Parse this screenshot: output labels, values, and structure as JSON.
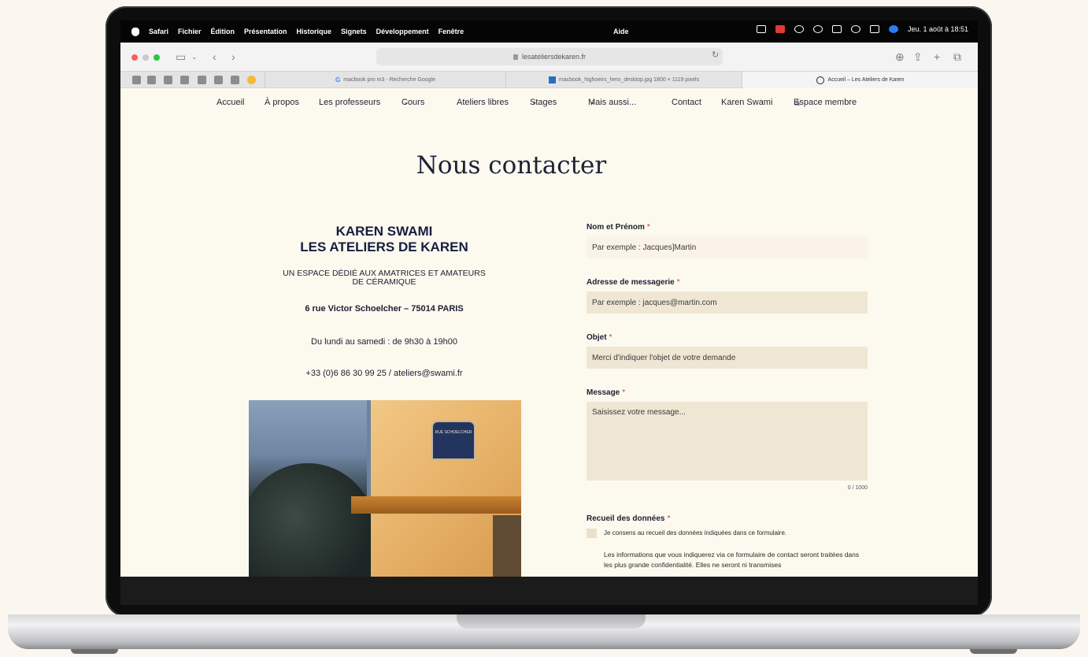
{
  "menubar": {
    "app": "Safari",
    "items": [
      "Fichier",
      "Édition",
      "Présentation",
      "Historique",
      "Signets",
      "Développement",
      "Fenêtre"
    ],
    "aide": "Aide",
    "clock": "Jeu. 1 août à 18:51"
  },
  "browser": {
    "url": "lesateliersdekaren.fr",
    "tabs": [
      {
        "label": "macbook pro m3 - Recherche Google"
      },
      {
        "label": "macbook_highoeirs_hero_desktop.jpg 1800 × 1119 pixels"
      },
      {
        "label": "Accueil – Les Ateliers de Karen"
      }
    ]
  },
  "nav": {
    "items": [
      "Accueil",
      "À propos",
      "Les professeurs",
      "Cours",
      "Ateliers libres",
      "Stages",
      "Mais aussi...",
      "Contact",
      "Karen Swami",
      "Espace membre"
    ]
  },
  "page": {
    "title": "Nous contacter",
    "name_line1": "KAREN SWAMI",
    "name_line2": "LES ATELIERS DE KAREN",
    "tagline_line1": "UN ESPACE DÉDIÉ AUX AMATRICES ET AMATEURS",
    "tagline_line2": "DE CÉRAMIQUE",
    "address": "6 rue Victor Schoelcher – 75014 PARIS",
    "hours": "Du lundi au samedi : de 9h30 à 19h00",
    "phone": "+33 (0)6 86 30 99 25 / ateliers@swami.fr",
    "photo_sign": "RUE SCHOELCHER"
  },
  "form": {
    "name_label": "Nom et Prénom",
    "name_placeholder": "Par exemple : Jacques]Martin",
    "email_label": "Adresse de messagerie",
    "email_placeholder": "Par exemple : jacques@martin.com",
    "subject_label": "Objet",
    "subject_placeholder": "Merci d'indiquer l'objet de votre demande",
    "message_label": "Message",
    "message_placeholder": "Saisissez votre message...",
    "counter": "0 / 1000",
    "consent_title": "Recueil des données",
    "consent_label": "Je consens au recueil des données indiquées dans ce formulaire.",
    "info_text": "Les informations que vous indiquerez via ce formulaire de contact seront traitées dans les plus grande confidentialité. Elles ne seront ni transmises",
    "required_mark": "*"
  },
  "colors": {
    "page_bg": "#fcf9ef",
    "field_bg": "#efe7d3",
    "heading": "#161e3e"
  }
}
